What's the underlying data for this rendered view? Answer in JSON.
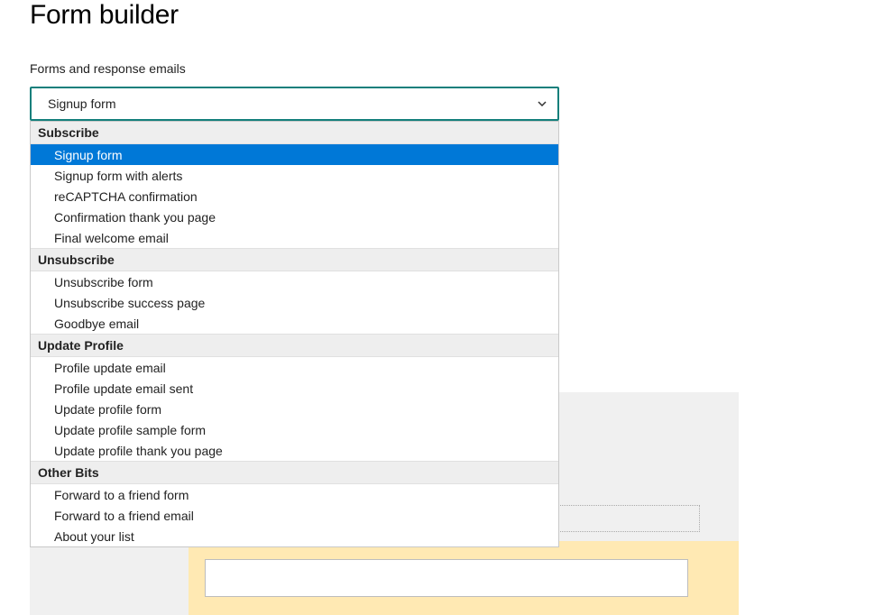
{
  "page_title": "Form builder",
  "section_label": "Forms and response emails",
  "select": {
    "current_value": "Signup form",
    "groups": [
      {
        "label": "Subscribe",
        "options": [
          {
            "label": "Signup form",
            "selected": true
          },
          {
            "label": "Signup form with alerts",
            "selected": false
          },
          {
            "label": "reCAPTCHA confirmation",
            "selected": false
          },
          {
            "label": "Confirmation thank you page",
            "selected": false
          },
          {
            "label": "Final welcome email",
            "selected": false
          }
        ]
      },
      {
        "label": "Unsubscribe",
        "options": [
          {
            "label": "Unsubscribe form",
            "selected": false
          },
          {
            "label": "Unsubscribe success page",
            "selected": false
          },
          {
            "label": "Goodbye email",
            "selected": false
          }
        ]
      },
      {
        "label": "Update Profile",
        "options": [
          {
            "label": "Profile update email",
            "selected": false
          },
          {
            "label": "Profile update email sent",
            "selected": false
          },
          {
            "label": "Update profile form",
            "selected": false
          },
          {
            "label": "Update profile sample form",
            "selected": false
          },
          {
            "label": "Update profile thank you page",
            "selected": false
          }
        ]
      },
      {
        "label": "Other Bits",
        "options": [
          {
            "label": "Forward to a friend form",
            "selected": false
          },
          {
            "label": "Forward to a friend email",
            "selected": false
          },
          {
            "label": "About your list",
            "selected": false
          }
        ]
      }
    ]
  }
}
